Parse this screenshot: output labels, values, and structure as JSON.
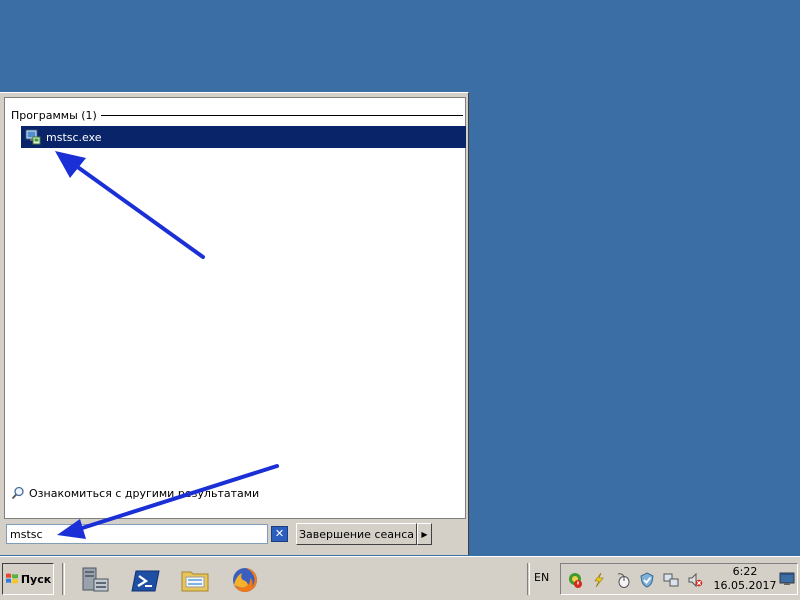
{
  "start_menu": {
    "group_header": "Программы (1)",
    "result_item": {
      "label": "mstsc.exe",
      "icon": "remote-desktop-icon"
    },
    "see_more_label": "Ознакомиться с другими результатами",
    "search": {
      "value": "mstsc"
    },
    "clear_button_label": "✕",
    "shutdown_label": "Завершение сеанса",
    "shutdown_arrow": "▶"
  },
  "taskbar": {
    "start_label": "Пуск",
    "quick_launch": [
      "server-manager-icon",
      "powershell-icon",
      "explorer-icon",
      "firefox-icon"
    ],
    "language": "EN",
    "tray_icons": [
      "update-warning-icon",
      "power-icon",
      "mouse-icon",
      "security-icon",
      "network-icon",
      "volume-muted-icon"
    ],
    "clock": {
      "time": "6:22",
      "date": "16.05.2017"
    }
  },
  "colors": {
    "desktop": "#3b6ea5",
    "selection": "#0a246a",
    "annotation_arrow": "#1a2fd6"
  }
}
